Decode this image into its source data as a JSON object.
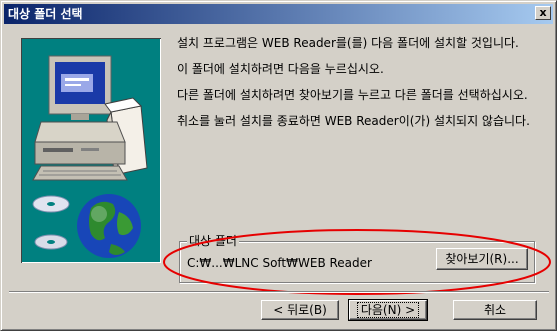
{
  "window": {
    "title": "대상 폴더 선택",
    "close_glyph": "x"
  },
  "body": {
    "paragraphs": [
      "설치 프로그램은 WEB Reader를(를) 다음 폴더에 설치할 것입니다.",
      "이 폴더에 설치하려면 다음을 누르십시오.",
      "다른 폴더에 설치하려면 찾아보기를 누르고 다른 폴더를 선택하십시오.",
      "취소를 눌러 설치를 종료하면 WEB Reader이(가) 설치되지 않습니다."
    ]
  },
  "destination": {
    "group_label": "대상 폴더",
    "path": "C:₩...₩LNC Soft₩WEB Reader",
    "browse_label": "찾아보기(R)..."
  },
  "buttons": {
    "back": "< 뒤로(B)",
    "next": "다음(N) >",
    "cancel": "취소"
  },
  "colors": {
    "titlebar_start": "#0a246a",
    "titlebar_end": "#a6caf0",
    "art_background": "#008080",
    "highlight_ellipse": "#e60000"
  }
}
